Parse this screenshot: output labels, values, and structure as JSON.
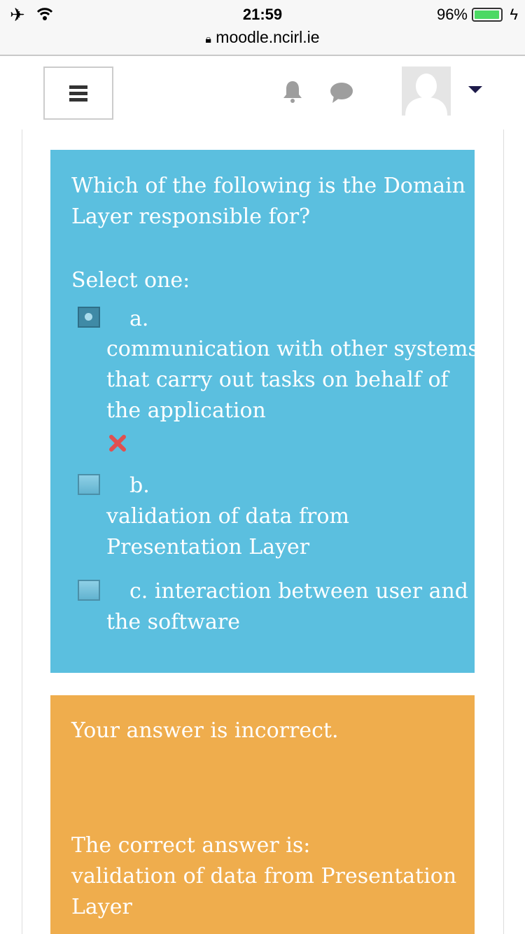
{
  "status_bar": {
    "time": "21:59",
    "battery": "96%",
    "battery_level": 0.96,
    "url": "moodle.ncirl.ie"
  },
  "question": {
    "text_lines": [
      "Which of the following is the Domain",
      "Layer responsible for?"
    ],
    "prompt": "Select one:",
    "options": [
      {
        "letter": "a.",
        "lines": [
          "communication with other systems",
          "that carry out tasks on behalf of",
          "the application"
        ],
        "selected": true,
        "incorrect": true
      },
      {
        "letter": "b.",
        "lines": [
          "validation of data from",
          "Presentation Layer"
        ],
        "selected": false
      },
      {
        "letter": "c. interaction between user and",
        "lines": [
          "the software"
        ],
        "selected": false
      }
    ]
  },
  "feedback": {
    "result": "Your answer is incorrect.",
    "correct_label": "The correct answer is:",
    "correct_lines": [
      "validation of data from Presentation",
      "Layer"
    ]
  },
  "colors": {
    "question_bg": "#5bbfdf",
    "feedback_bg": "#efad4d",
    "incorrect": "#e05050"
  }
}
